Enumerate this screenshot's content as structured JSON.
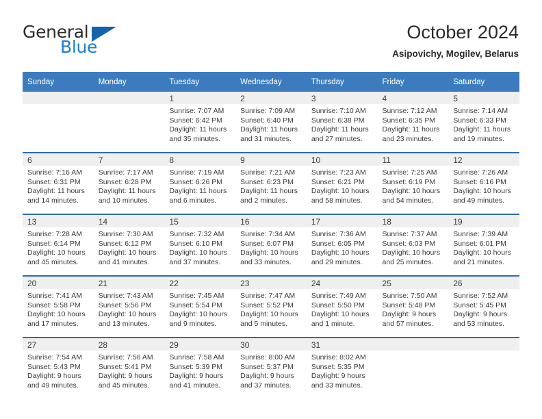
{
  "brand": {
    "word1": "General",
    "word2": "Blue",
    "triangle_color": "#1364ad",
    "blue_text_color": "#1a7fd4",
    "logo_name": "general-blue-logo"
  },
  "header": {
    "title": "October 2024",
    "subtitle": "Asipovichy, Mogilev, Belarus"
  },
  "theme": {
    "header_blue": "#3c7cbe",
    "row_divider_blue": "#2b6ca8",
    "daynum_strip_gray": "#efefef",
    "text": "#3a3a3a"
  },
  "calendar": {
    "weekday_headers": [
      "Sunday",
      "Monday",
      "Tuesday",
      "Wednesday",
      "Thursday",
      "Friday",
      "Saturday"
    ],
    "weeks": [
      [
        {
          "empty": true
        },
        {
          "empty": true
        },
        {
          "day": "1",
          "sunrise": "Sunrise: 7:07 AM",
          "sunset": "Sunset: 6:42 PM",
          "daylight": "Daylight: 11 hours and 35 minutes."
        },
        {
          "day": "2",
          "sunrise": "Sunrise: 7:09 AM",
          "sunset": "Sunset: 6:40 PM",
          "daylight": "Daylight: 11 hours and 31 minutes."
        },
        {
          "day": "3",
          "sunrise": "Sunrise: 7:10 AM",
          "sunset": "Sunset: 6:38 PM",
          "daylight": "Daylight: 11 hours and 27 minutes."
        },
        {
          "day": "4",
          "sunrise": "Sunrise: 7:12 AM",
          "sunset": "Sunset: 6:35 PM",
          "daylight": "Daylight: 11 hours and 23 minutes."
        },
        {
          "day": "5",
          "sunrise": "Sunrise: 7:14 AM",
          "sunset": "Sunset: 6:33 PM",
          "daylight": "Daylight: 11 hours and 19 minutes."
        }
      ],
      [
        {
          "day": "6",
          "sunrise": "Sunrise: 7:16 AM",
          "sunset": "Sunset: 6:31 PM",
          "daylight": "Daylight: 11 hours and 14 minutes."
        },
        {
          "day": "7",
          "sunrise": "Sunrise: 7:17 AM",
          "sunset": "Sunset: 6:28 PM",
          "daylight": "Daylight: 11 hours and 10 minutes."
        },
        {
          "day": "8",
          "sunrise": "Sunrise: 7:19 AM",
          "sunset": "Sunset: 6:26 PM",
          "daylight": "Daylight: 11 hours and 6 minutes."
        },
        {
          "day": "9",
          "sunrise": "Sunrise: 7:21 AM",
          "sunset": "Sunset: 6:23 PM",
          "daylight": "Daylight: 11 hours and 2 minutes."
        },
        {
          "day": "10",
          "sunrise": "Sunrise: 7:23 AM",
          "sunset": "Sunset: 6:21 PM",
          "daylight": "Daylight: 10 hours and 58 minutes."
        },
        {
          "day": "11",
          "sunrise": "Sunrise: 7:25 AM",
          "sunset": "Sunset: 6:19 PM",
          "daylight": "Daylight: 10 hours and 54 minutes."
        },
        {
          "day": "12",
          "sunrise": "Sunrise: 7:26 AM",
          "sunset": "Sunset: 6:16 PM",
          "daylight": "Daylight: 10 hours and 49 minutes."
        }
      ],
      [
        {
          "day": "13",
          "sunrise": "Sunrise: 7:28 AM",
          "sunset": "Sunset: 6:14 PM",
          "daylight": "Daylight: 10 hours and 45 minutes."
        },
        {
          "day": "14",
          "sunrise": "Sunrise: 7:30 AM",
          "sunset": "Sunset: 6:12 PM",
          "daylight": "Daylight: 10 hours and 41 minutes."
        },
        {
          "day": "15",
          "sunrise": "Sunrise: 7:32 AM",
          "sunset": "Sunset: 6:10 PM",
          "daylight": "Daylight: 10 hours and 37 minutes."
        },
        {
          "day": "16",
          "sunrise": "Sunrise: 7:34 AM",
          "sunset": "Sunset: 6:07 PM",
          "daylight": "Daylight: 10 hours and 33 minutes."
        },
        {
          "day": "17",
          "sunrise": "Sunrise: 7:36 AM",
          "sunset": "Sunset: 6:05 PM",
          "daylight": "Daylight: 10 hours and 29 minutes."
        },
        {
          "day": "18",
          "sunrise": "Sunrise: 7:37 AM",
          "sunset": "Sunset: 6:03 PM",
          "daylight": "Daylight: 10 hours and 25 minutes."
        },
        {
          "day": "19",
          "sunrise": "Sunrise: 7:39 AM",
          "sunset": "Sunset: 6:01 PM",
          "daylight": "Daylight: 10 hours and 21 minutes."
        }
      ],
      [
        {
          "day": "20",
          "sunrise": "Sunrise: 7:41 AM",
          "sunset": "Sunset: 5:58 PM",
          "daylight": "Daylight: 10 hours and 17 minutes."
        },
        {
          "day": "21",
          "sunrise": "Sunrise: 7:43 AM",
          "sunset": "Sunset: 5:56 PM",
          "daylight": "Daylight: 10 hours and 13 minutes."
        },
        {
          "day": "22",
          "sunrise": "Sunrise: 7:45 AM",
          "sunset": "Sunset: 5:54 PM",
          "daylight": "Daylight: 10 hours and 9 minutes."
        },
        {
          "day": "23",
          "sunrise": "Sunrise: 7:47 AM",
          "sunset": "Sunset: 5:52 PM",
          "daylight": "Daylight: 10 hours and 5 minutes."
        },
        {
          "day": "24",
          "sunrise": "Sunrise: 7:49 AM",
          "sunset": "Sunset: 5:50 PM",
          "daylight": "Daylight: 10 hours and 1 minute."
        },
        {
          "day": "25",
          "sunrise": "Sunrise: 7:50 AM",
          "sunset": "Sunset: 5:48 PM",
          "daylight": "Daylight: 9 hours and 57 minutes."
        },
        {
          "day": "26",
          "sunrise": "Sunrise: 7:52 AM",
          "sunset": "Sunset: 5:45 PM",
          "daylight": "Daylight: 9 hours and 53 minutes."
        }
      ],
      [
        {
          "day": "27",
          "sunrise": "Sunrise: 7:54 AM",
          "sunset": "Sunset: 5:43 PM",
          "daylight": "Daylight: 9 hours and 49 minutes."
        },
        {
          "day": "28",
          "sunrise": "Sunrise: 7:56 AM",
          "sunset": "Sunset: 5:41 PM",
          "daylight": "Daylight: 9 hours and 45 minutes."
        },
        {
          "day": "29",
          "sunrise": "Sunrise: 7:58 AM",
          "sunset": "Sunset: 5:39 PM",
          "daylight": "Daylight: 9 hours and 41 minutes."
        },
        {
          "day": "30",
          "sunrise": "Sunrise: 8:00 AM",
          "sunset": "Sunset: 5:37 PM",
          "daylight": "Daylight: 9 hours and 37 minutes."
        },
        {
          "day": "31",
          "sunrise": "Sunrise: 8:02 AM",
          "sunset": "Sunset: 5:35 PM",
          "daylight": "Daylight: 9 hours and 33 minutes."
        },
        {
          "empty": true
        },
        {
          "empty": true
        }
      ]
    ]
  }
}
